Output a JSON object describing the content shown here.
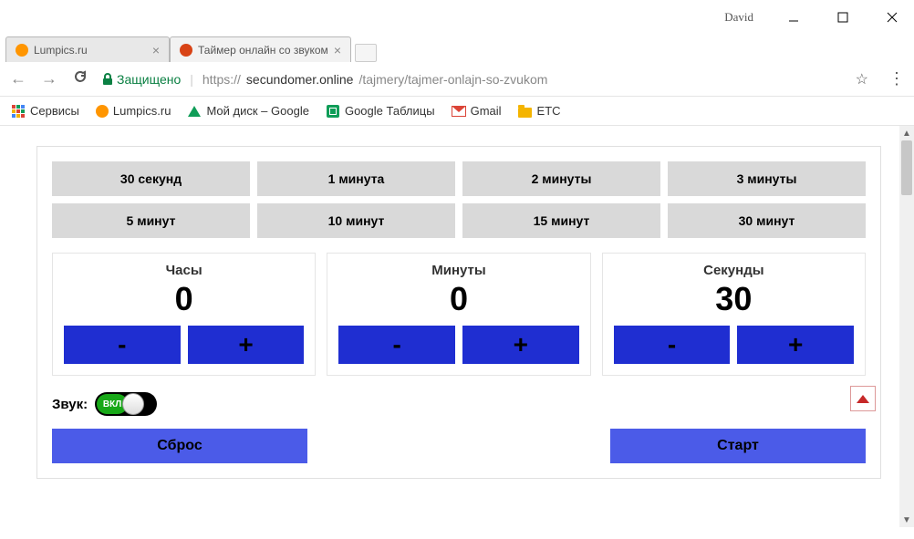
{
  "window": {
    "username": "David"
  },
  "tabs": [
    {
      "title": "Lumpics.ru",
      "favicon_color": "#ff9500"
    },
    {
      "title": "Таймер онлайн со звуком",
      "favicon_color": "#d84315"
    }
  ],
  "addressbar": {
    "secure_label": "Защищено",
    "url_protocol": "https://",
    "url_host": "secundomer.online",
    "url_path": "/tajmery/tajmer-onlajn-so-zvukom"
  },
  "bookmarks": {
    "apps": "Сервисы",
    "items": [
      "Lumpics.ru",
      "Мой диск – Google",
      "Google Таблицы",
      "Gmail",
      "ETC"
    ]
  },
  "timer": {
    "presets": [
      "30 секунд",
      "1 минута",
      "2 минуты",
      "3 минуты",
      "5 минут",
      "10 минут",
      "15 минут",
      "30 минут"
    ],
    "units": [
      {
        "label": "Часы",
        "value": "0"
      },
      {
        "label": "Минуты",
        "value": "0"
      },
      {
        "label": "Секунды",
        "value": "30"
      }
    ],
    "btn_minus": "-",
    "btn_plus": "+",
    "sound_label": "Звук:",
    "sound_on_text": "ВКЛ",
    "reset_label": "Сброс",
    "start_label": "Старт"
  }
}
